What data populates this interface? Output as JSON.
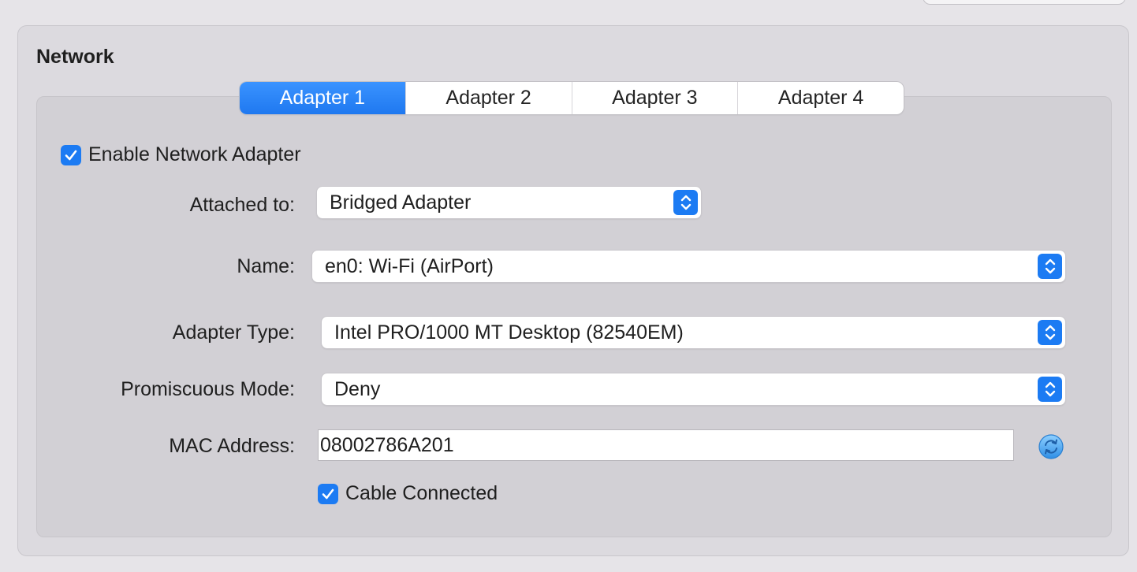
{
  "group": {
    "title": "Network"
  },
  "tabs": [
    {
      "label": "Adapter 1",
      "active": true
    },
    {
      "label": "Adapter 2",
      "active": false
    },
    {
      "label": "Adapter 3",
      "active": false
    },
    {
      "label": "Adapter 4",
      "active": false
    }
  ],
  "enable_adapter": {
    "label": "Enable Network Adapter",
    "checked": true
  },
  "fields": {
    "attached_to": {
      "label": "Attached to:",
      "value": "Bridged Adapter"
    },
    "name": {
      "label": "Name:",
      "value": "en0: Wi-Fi (AirPort)"
    },
    "adapter_type": {
      "label": "Adapter Type:",
      "value": "Intel PRO/1000 MT Desktop (82540EM)"
    },
    "promiscuous_mode": {
      "label": "Promiscuous Mode:",
      "value": "Deny"
    },
    "mac_address": {
      "label": "MAC Address:",
      "value": "08002786A201"
    }
  },
  "cable_connected": {
    "label": "Cable Connected",
    "checked": true
  },
  "icons": {
    "checkbox": "checkmark-icon",
    "popup": "chevron-up-down-icon",
    "refresh": "refresh-mac-icon"
  },
  "colors": {
    "accent": "#1c7bf3",
    "panel": "#d2d0d5",
    "background": "#e6e4e8"
  }
}
